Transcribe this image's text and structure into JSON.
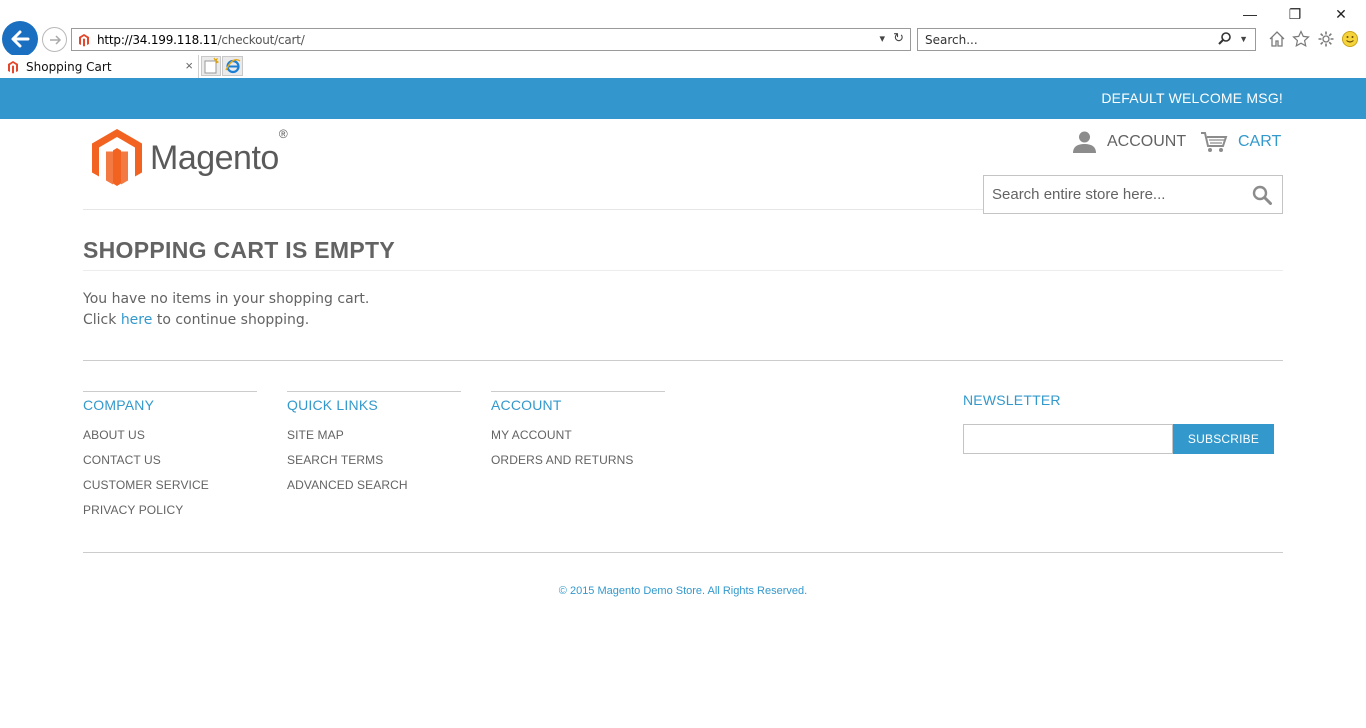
{
  "browser": {
    "url_domain": "http://34.199.118.11",
    "url_path": "/checkout/cart/",
    "search_placeholder": "Search...",
    "tab_title": "Shopping Cart",
    "tab_close": "×",
    "win_minimize": "—",
    "win_restore": "❐",
    "win_close": "✕"
  },
  "site": {
    "welcome": "DEFAULT WELCOME MSG!",
    "logo_text": "Magento",
    "logo_reg": "®",
    "account_label": "ACCOUNT",
    "cart_label": "CART",
    "search_placeholder": "Search entire store here..."
  },
  "main": {
    "title": "SHOPPING CART IS EMPTY",
    "empty_message": "You have no items in your shopping cart.",
    "click_prefix": "Click ",
    "click_link": "here",
    "click_suffix": " to continue shopping."
  },
  "footer": {
    "columns": [
      {
        "title": "COMPANY",
        "links": [
          "ABOUT US",
          "CONTACT US",
          "CUSTOMER SERVICE",
          "PRIVACY POLICY"
        ]
      },
      {
        "title": "QUICK LINKS",
        "links": [
          "SITE MAP",
          "SEARCH TERMS",
          "ADVANCED SEARCH"
        ]
      },
      {
        "title": "ACCOUNT",
        "links": [
          "MY ACCOUNT",
          "ORDERS AND RETURNS"
        ]
      }
    ],
    "newsletter_title": "NEWSLETTER",
    "subscribe_label": "SUBSCRIBE",
    "copyright": "© 2015 Magento Demo Store. All Rights Reserved."
  },
  "colors": {
    "accent": "#3399cc",
    "topbar": "#3396cc",
    "logo_orange": "#f26322",
    "text": "#636363"
  }
}
